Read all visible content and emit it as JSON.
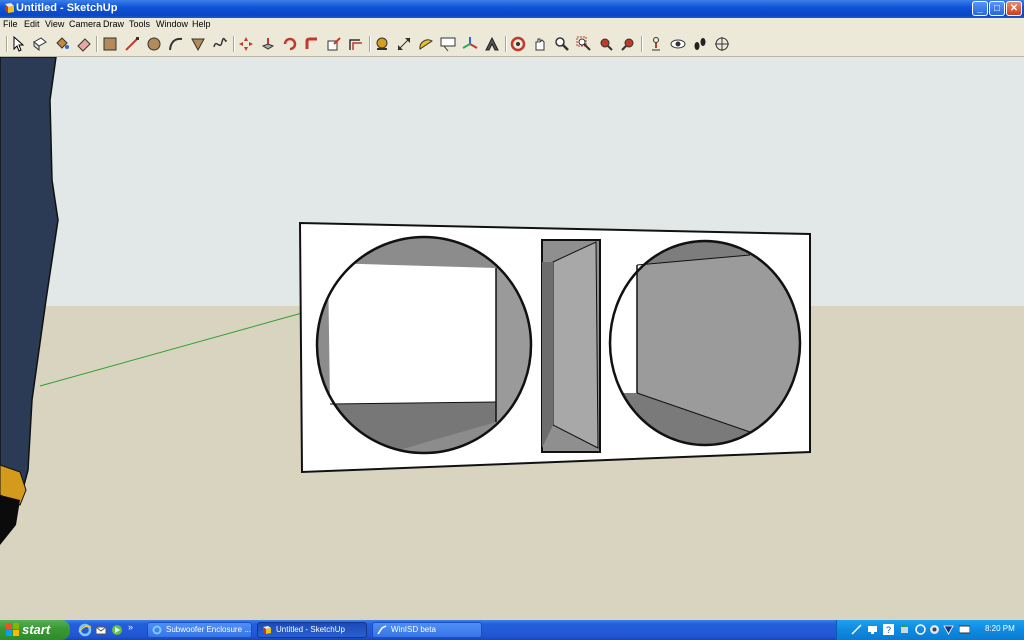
{
  "window": {
    "title": "Untitled - SketchUp",
    "controls": {
      "minimize": "_",
      "maximize": "□",
      "close": "✕"
    }
  },
  "menu": [
    "File",
    "Edit",
    "View",
    "Camera",
    "Draw",
    "Tools",
    "Window",
    "Help"
  ],
  "toolbar": {
    "tools": [
      "select-icon",
      "make-component-icon",
      "paint-bucket-icon",
      "eraser-icon",
      "rectangle-icon",
      "line-icon",
      "circle-icon",
      "arc-icon",
      "polygon-icon",
      "freehand-icon",
      "move-icon",
      "push-pull-icon",
      "rotate-icon",
      "follow-me-icon",
      "scale-icon",
      "offset-icon",
      "tape-measure-icon",
      "dimension-icon",
      "protractor-icon",
      "text-icon",
      "axes-icon",
      "3d-text-icon",
      "orbit-icon",
      "pan-icon",
      "zoom-icon",
      "zoom-window-icon",
      "previous-view-icon",
      "next-view-icon",
      "position-camera-icon",
      "look-around-icon",
      "walk-icon",
      "section-plane-icon"
    ]
  },
  "colors": {
    "sky": "#e3e8e9",
    "ground": "#d7d3bf",
    "panel_white": "#ffffff",
    "interior_gray": "#8f8f8f",
    "taskbar": "#245fdc",
    "tray": "#0f8ae0"
  },
  "taskbar": {
    "start_label": "start",
    "quick_launch": [
      "ie-icon",
      "outlook-icon",
      "media-player-icon"
    ],
    "chevron": "»",
    "items": [
      {
        "label": "Subwoofer Enclosure ...",
        "icon": "ie-icon",
        "active": false
      },
      {
        "label": "Untitled - SketchUp",
        "icon": "sketchup-icon",
        "active": true
      },
      {
        "label": "WinISD beta",
        "icon": "winisd-icon",
        "active": false
      }
    ],
    "tray_icons": [
      "network-icon",
      "display-icon",
      "help-icon",
      "safely-remove-icon",
      "sync-icon",
      "volume-icon",
      "shield-icon",
      "monitor-icon"
    ],
    "clock": "8:20 PM"
  }
}
